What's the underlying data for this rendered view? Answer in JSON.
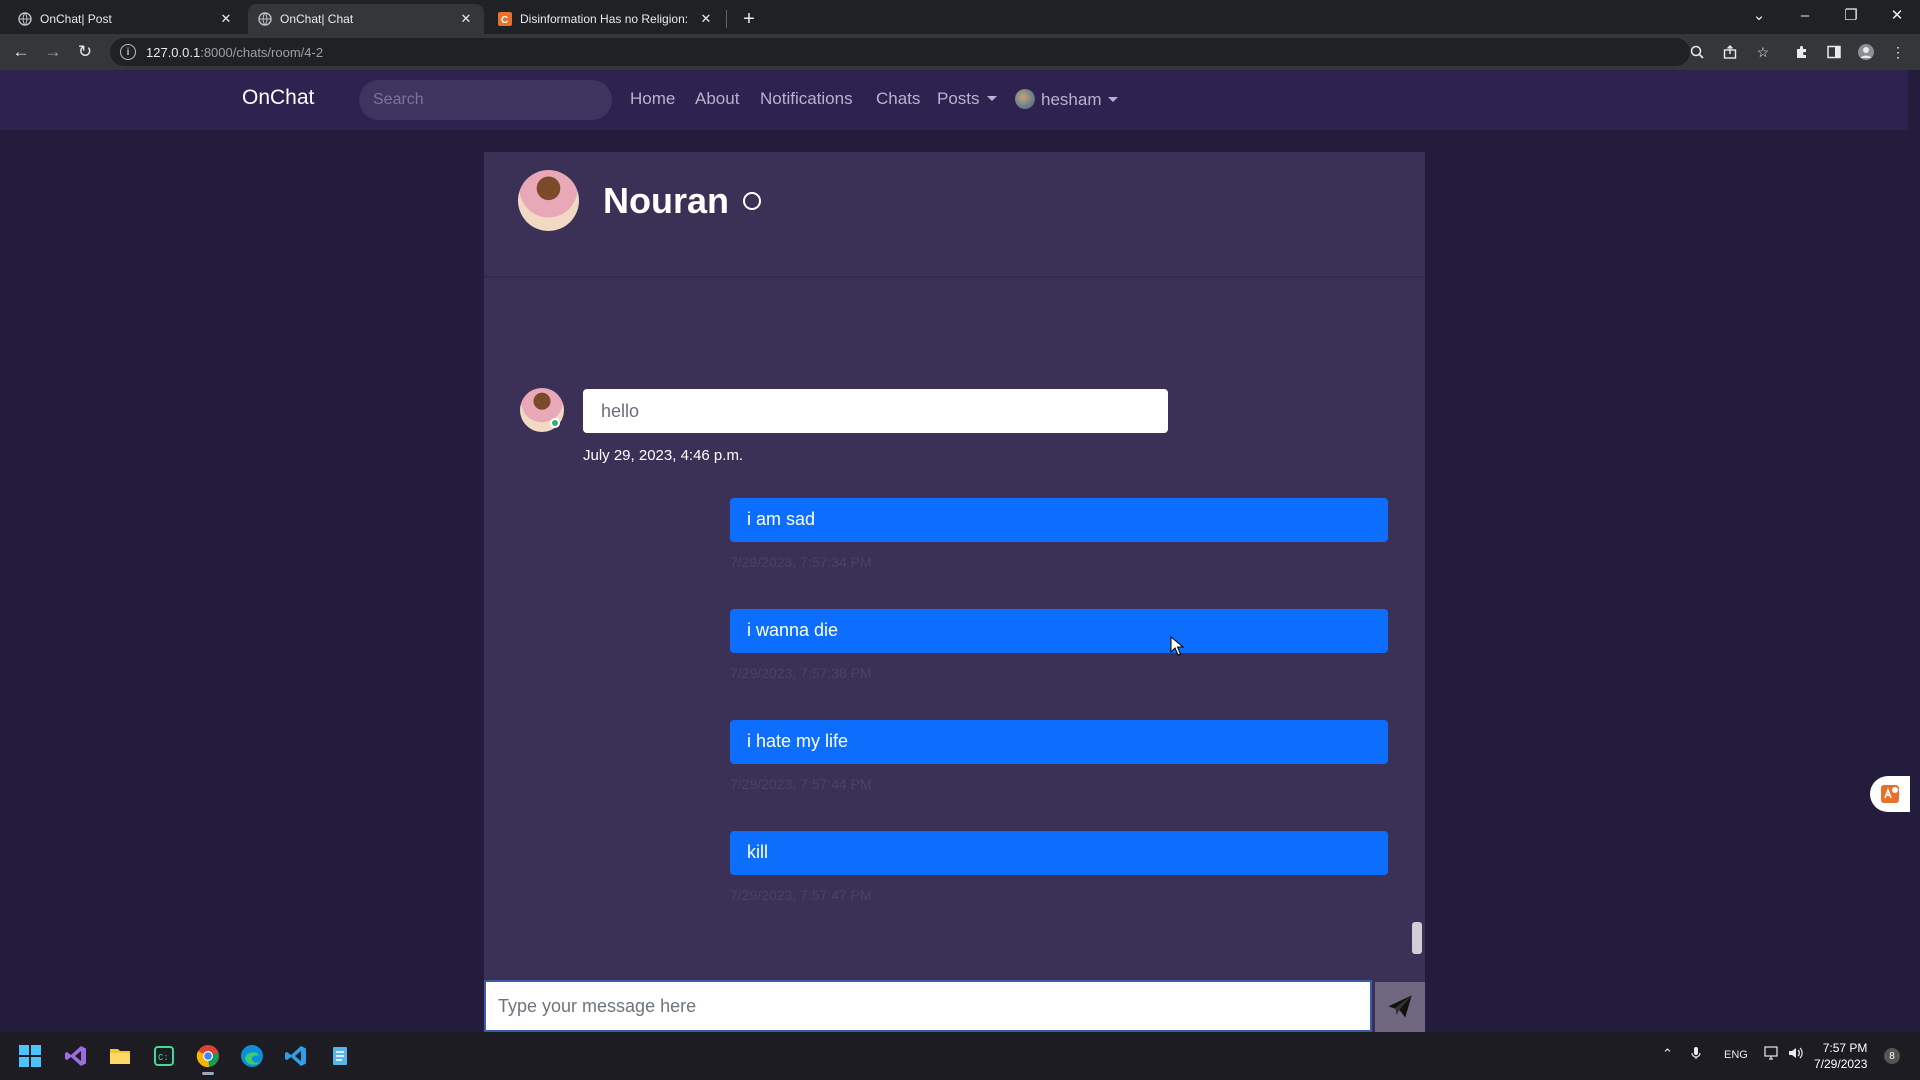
{
  "browser": {
    "tabs": [
      {
        "title": "OnChat| Post"
      },
      {
        "title": "OnChat| Chat"
      },
      {
        "title": "Disinformation Has no Religion: "
      }
    ],
    "url_host": "127.0.0.1",
    "url_path": ":8000/chats/room/4-2"
  },
  "navbar": {
    "brand": "OnChat",
    "search_placeholder": "Search",
    "links": {
      "home": "Home",
      "about": "About",
      "notifications": "Notifications",
      "chats": "Chats",
      "posts": "Posts"
    },
    "user": "hesham"
  },
  "chat": {
    "partner_name": "Nouran",
    "messages": [
      {
        "direction": "incoming",
        "text": "hello",
        "time": "July 29, 2023, 4:46 p.m."
      },
      {
        "direction": "outgoing",
        "text": "i am sad",
        "time": "7/29/2023, 7:57:34 PM"
      },
      {
        "direction": "outgoing",
        "text": "i wanna die",
        "time": "7/29/2023, 7:57:38 PM"
      },
      {
        "direction": "outgoing",
        "text": "i hate my life",
        "time": "7/29/2023, 7:57:44 PM"
      },
      {
        "direction": "outgoing",
        "text": "kill",
        "time": "7/29/2023, 7:57:47 PM"
      }
    ],
    "input_placeholder": "Type your message here"
  },
  "taskbar": {
    "language": "ENG",
    "time": "7:57 PM",
    "date": "7/29/2023",
    "notification_count": "8"
  },
  "colors": {
    "page_bg": "#231c3d",
    "navbar_bg": "#2d2250",
    "panel_bg": "#3b3157",
    "outgoing_bubble": "#0d6efd"
  }
}
